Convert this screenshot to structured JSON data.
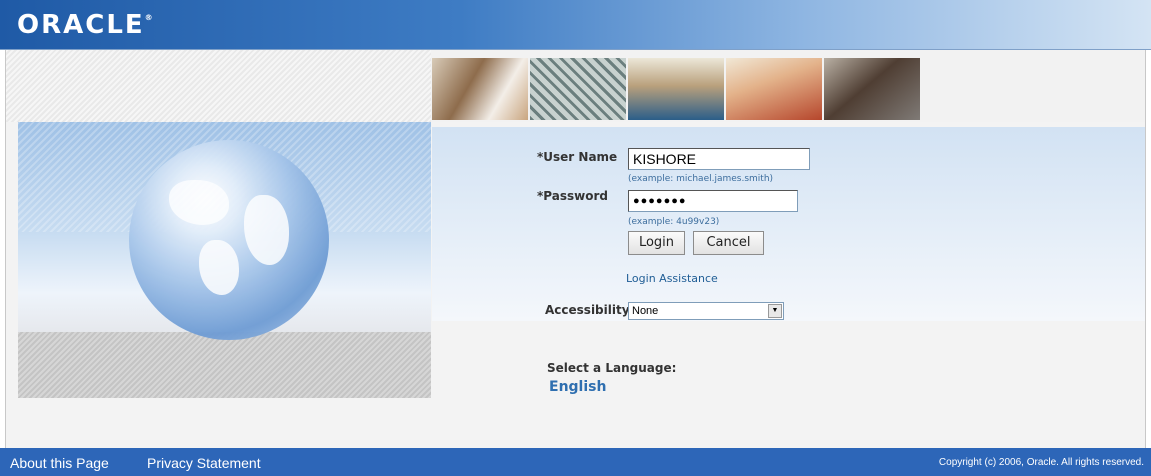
{
  "header": {
    "logo_text": "ORACLE",
    "logo_mark": "®"
  },
  "login": {
    "username_label": "*User Name",
    "username_value": "KISHORE",
    "username_hint": "(example: michael.james.smith)",
    "password_label": "*Password",
    "password_value": "●●●●●●●",
    "password_hint": "(example: 4u99v23)",
    "login_button": "Login",
    "cancel_button": "Cancel",
    "assistance_link": "Login Assistance",
    "accessibility_label": "Accessibility",
    "accessibility_value": "None"
  },
  "language": {
    "label": "Select a Language:",
    "option": "English"
  },
  "footer": {
    "about_link": "About this Page",
    "privacy_link": "Privacy Statement",
    "copyright": "Copyright (c) 2006, Oracle. All rights reserved."
  },
  "colors": {
    "brand_blue": "#2d66b8",
    "link_blue": "#1f5d95",
    "panel_blue": "#d2e2f3"
  }
}
